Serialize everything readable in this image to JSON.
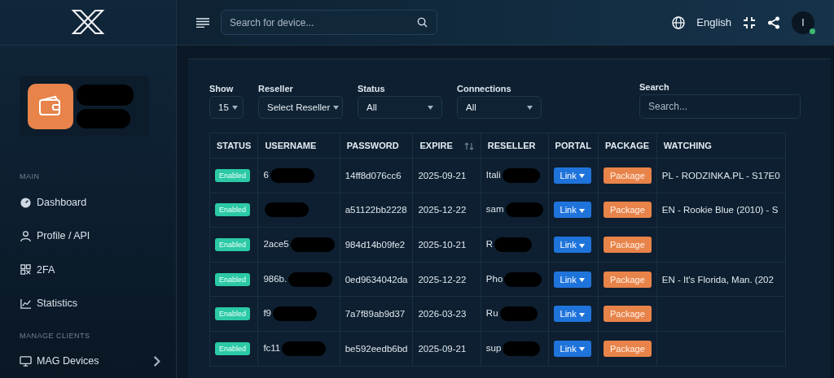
{
  "topbar": {
    "search": {
      "placeholder": "Search for device..."
    },
    "language": "English",
    "avatar": {
      "initial": "I",
      "online": true
    }
  },
  "sidebar": {
    "profile": {
      "redacted": true
    },
    "sections": [
      {
        "title": "MAIN",
        "items": [
          {
            "label": "Dashboard",
            "expandable": false
          },
          {
            "label": "Profile / API",
            "expandable": false
          },
          {
            "label": "2FA",
            "expandable": false
          },
          {
            "label": "Statistics",
            "expandable": false
          }
        ]
      },
      {
        "title": "MANAGE CLIENTS",
        "items": [
          {
            "label": "MAG Devices",
            "expandable": true
          }
        ]
      }
    ]
  },
  "filters": {
    "show": {
      "label": "Show",
      "value": "15"
    },
    "reseller": {
      "label": "Reseller",
      "value": "Select Reseller"
    },
    "status": {
      "label": "Status",
      "value": "All"
    },
    "connections": {
      "label": "Connections",
      "value": "All"
    },
    "search": {
      "label": "Search",
      "placeholder": "Search..."
    }
  },
  "table": {
    "columns": [
      {
        "label": "STATUS",
        "sortable": false
      },
      {
        "label": "USERNAME",
        "sortable": false
      },
      {
        "label": "PASSWORD",
        "sortable": false
      },
      {
        "label": "EXPIRE",
        "sortable": true
      },
      {
        "label": "RESELLER",
        "sortable": false
      },
      {
        "label": "PORTAL",
        "sortable": false
      },
      {
        "label": "PACKAGE",
        "sortable": false
      },
      {
        "label": "WATCHING",
        "sortable": false
      }
    ],
    "rows": [
      {
        "status": "Enabled",
        "username": "6",
        "password": "14ff8d076cc6",
        "expire": "2025-09-21",
        "reseller": "Itali",
        "portal": "Link",
        "package": "Package",
        "watching": "PL - RODZINKA.PL - S17E0",
        "redacted": true
      },
      {
        "status": "Enabled",
        "password": "a51122bb2228",
        "expire": "2025-12-22",
        "reseller": "sam",
        "portal": "Link",
        "package": "Package",
        "watching": "EN - Rookie Blue (2010) - S",
        "redacted": true
      },
      {
        "status": "Enabled",
        "username": "2ace5",
        "password": "984d14b09fe2",
        "expire": "2025-10-21",
        "reseller": "R",
        "portal": "Link",
        "package": "Package",
        "redacted": true
      },
      {
        "status": "Enabled",
        "username": "986b.",
        "password": "0ed9634042da",
        "expire": "2025-12-22",
        "reseller": "Pho",
        "portal": "Link",
        "package": "Package",
        "watching": "EN - It's Florida, Man. (202",
        "redacted": true
      },
      {
        "status": "Enabled",
        "username": "f9",
        "password": "7a7f89ab9d37",
        "expire": "2026-03-23",
        "reseller": "Ru",
        "portal": "Link",
        "package": "Package",
        "redacted": true
      },
      {
        "status": "Enabled",
        "username": "fc11",
        "password": "be592eedb6bd",
        "expire": "2025-09-21",
        "reseller": "sup",
        "portal": "Link",
        "package": "Package",
        "redacted": true
      }
    ]
  }
}
